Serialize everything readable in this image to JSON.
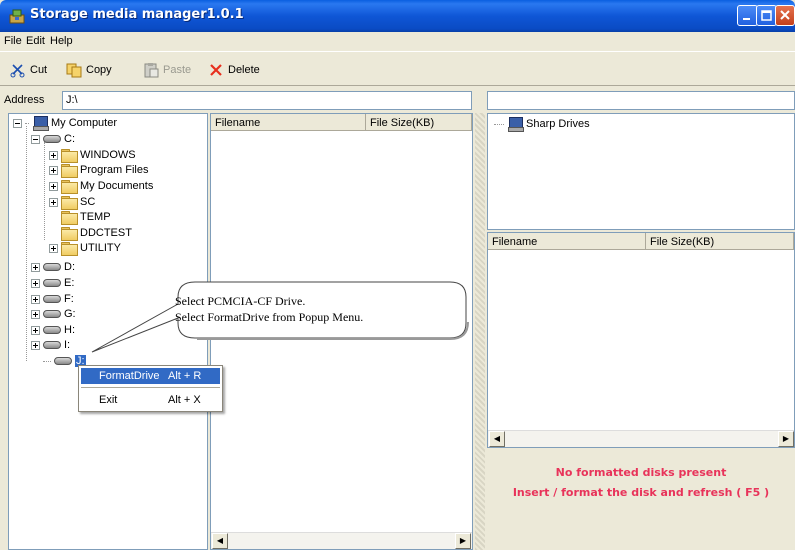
{
  "window": {
    "title": "Storage media manager1.0.1"
  },
  "menubar": {
    "items": [
      "File",
      "Edit",
      "Help"
    ]
  },
  "toolbar": {
    "cut": "Cut",
    "copy": "Copy",
    "paste": "Paste",
    "delete": "Delete"
  },
  "address": {
    "label": "Address",
    "value": "J:\\"
  },
  "tree": {
    "root": "My Computer",
    "drive_c": "C:",
    "folders": [
      "WINDOWS",
      "Program Files",
      "My Documents",
      "SC",
      "TEMP",
      "DDCTEST",
      "UTILITY"
    ],
    "drives": [
      "D:",
      "E:",
      "F:",
      "G:",
      "H:",
      "I:"
    ],
    "drive_j": "J:"
  },
  "list": {
    "col_filename": "Filename",
    "col_size": "File Size(KB)"
  },
  "sharp": {
    "root": "Sharp Drives"
  },
  "right_list": {
    "col_filename": "Filename",
    "col_size": "File Size(KB)"
  },
  "status": {
    "line1": "No formatted disks present",
    "line2": "Insert / format the disk and refresh ( F5 )",
    "color": "#e8335a"
  },
  "context_menu": {
    "format_label": "FormatDrive",
    "format_shortcut": "Alt + R",
    "exit_label": "Exit",
    "exit_shortcut": "Alt + X"
  },
  "callout": {
    "line1": "Select PCMCIA-CF Drive.",
    "line2": "Select FormatDrive from Popup Menu."
  }
}
